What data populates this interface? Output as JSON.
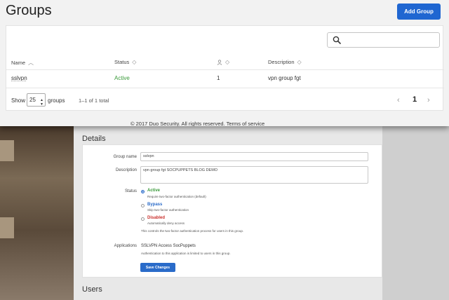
{
  "header": {
    "title": "Groups",
    "add_group_label": "Add Group"
  },
  "search": {
    "placeholder": "",
    "icon": "search-icon"
  },
  "table": {
    "columns": [
      {
        "label": "Name",
        "sort": "asc"
      },
      {
        "label": "Status",
        "sort": "none"
      },
      {
        "label": "",
        "icon": "user-icon",
        "sort": "none"
      },
      {
        "label": "Description",
        "sort": "none"
      }
    ],
    "rows": [
      {
        "name": "sslvpn",
        "status": "Active",
        "users": "1",
        "description": "vpn group fgt"
      }
    ]
  },
  "pagination": {
    "show_label": "Show",
    "per_page": "25",
    "groups_label": "groups",
    "range": "1–1 of 1 total",
    "current_page": "1",
    "prev_icon": "chevron-left-icon",
    "next_icon": "chevron-right-icon"
  },
  "footer": {
    "text": "© 2017 Duo Security. All rights reserved. Terms of service"
  },
  "details": {
    "title": "Details",
    "group_name_label": "Group name",
    "group_name_value": "sslvpn",
    "description_label": "Description",
    "description_value": "vpn group fgt SOCPUPPETS BLOG DEMO",
    "status_label": "Status",
    "status_options": [
      {
        "name": "Active",
        "desc": "Require two-factor authentication (default)",
        "selected": true,
        "color": "#3a9a3a"
      },
      {
        "name": "Bypass",
        "desc": "Skip two-factor authentication",
        "selected": false,
        "color": "#2a6bc9"
      },
      {
        "name": "Disabled",
        "desc": "Automatically deny access",
        "selected": false,
        "color": "#c9302c"
      }
    ],
    "status_note": "This controls the two-factor authentication process for users in this group.",
    "applications_label": "Applications",
    "applications_value": "SSLVPN Access SocPuppets",
    "applications_note": "Authentication to this application is limited to users in this group.",
    "save_label": "Save Changes",
    "users_title": "Users"
  },
  "colors": {
    "primary_button": "#1f66d1",
    "active_status": "#3a9a3a"
  }
}
